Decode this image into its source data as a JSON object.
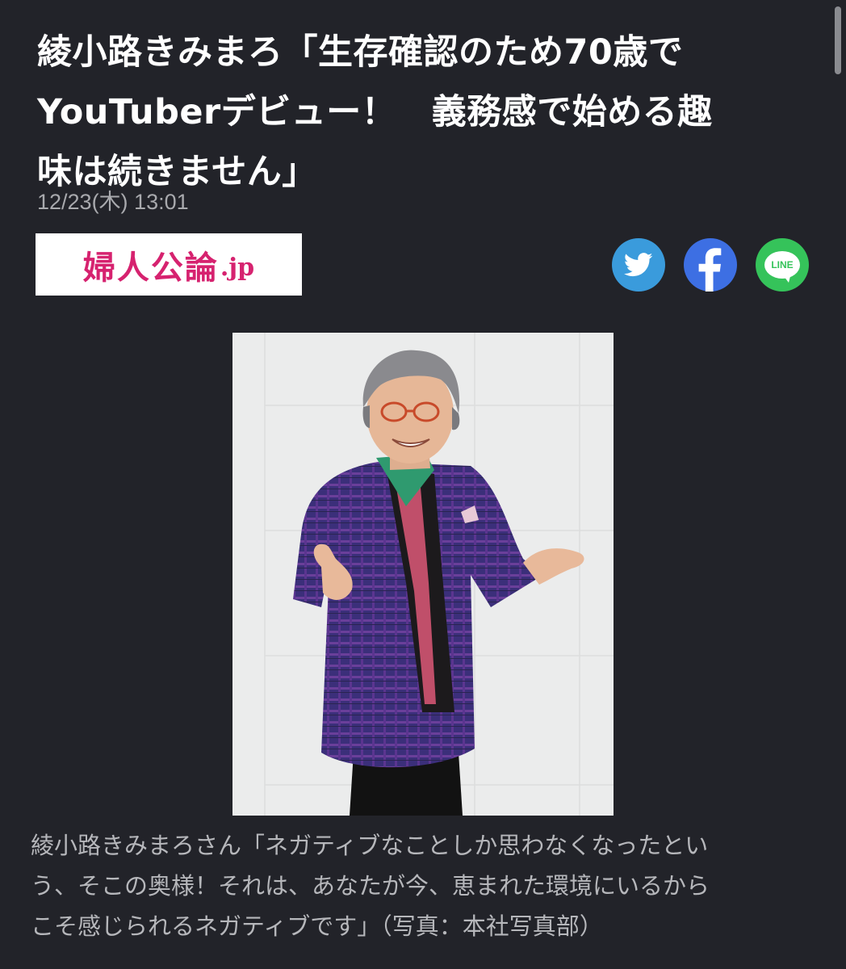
{
  "article": {
    "title_lines": [
      "綾小路きみまろ「生存確認のため70歳で",
      "YouTuberデビュー！　義務感で始める趣",
      "味は続きません」"
    ],
    "date": "12/23(木) 13:01"
  },
  "publisher": {
    "logo_main": "婦人公論",
    "logo_suffix": ".jp",
    "brand_color": "#d6226f"
  },
  "share": {
    "twitter_icon": "twitter-bird-icon",
    "facebook_icon": "facebook-f-icon",
    "line_label": "LINE",
    "twitter_color": "#3a9bdc",
    "facebook_color": "#3d6fe3",
    "line_color": "#35c35a"
  },
  "photo": {
    "subject": "man-in-purple-plaid-jacket-photo"
  },
  "caption": {
    "lines": [
      "綾小路きみまろさん「ネガティブなことしか思わなくなったとい",
      "う、そこの奥様！それは、あなたが今、恵まれた環境にいるから",
      "こそ感じられるネガティブです」（写真：本社写真部）"
    ]
  }
}
